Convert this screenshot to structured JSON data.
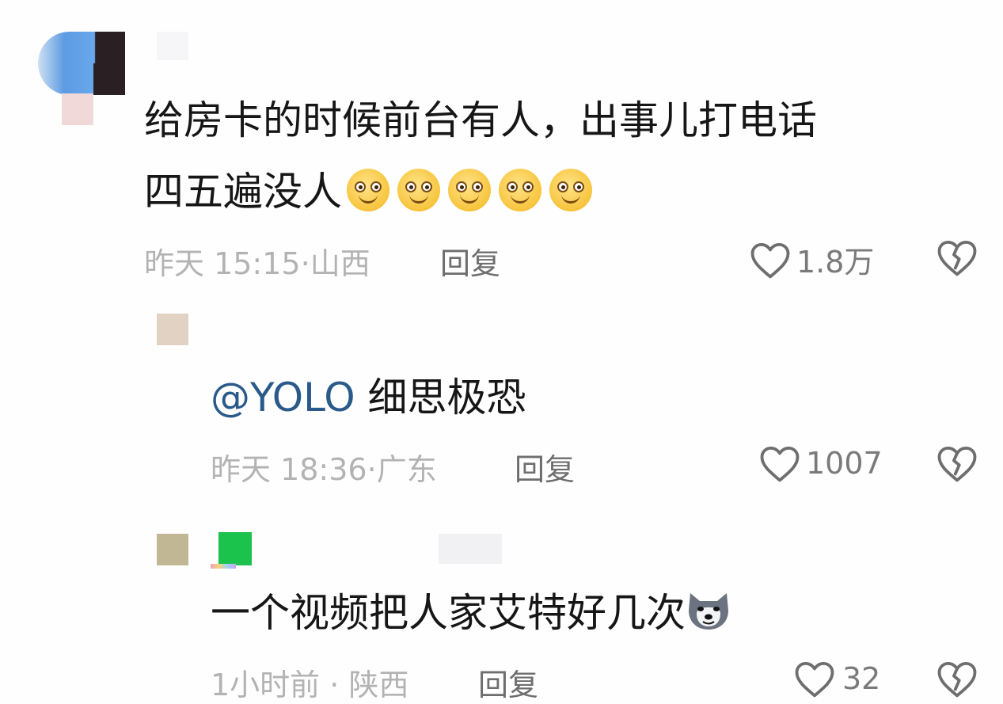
{
  "comments": [
    {
      "body": "给房卡的时候前台有人，出事儿打电话",
      "body_line2": "四五遍没人",
      "emoji_name": "wow-face-icon",
      "emoji_count": 5,
      "time": "昨天 15:15",
      "location": "山西",
      "reply_label": "回复",
      "likes": "1.8万"
    },
    {
      "mention": "@YOLO",
      "body": "细思极恐",
      "time": "昨天 18:36",
      "location": "广东",
      "reply_label": "回复",
      "likes": "1007"
    },
    {
      "body": "一个视频把人家艾特好几次",
      "emoji_name": "husky-dog-icon",
      "time": "1小时前",
      "location": "陕西",
      "reply_label": "回复",
      "likes": "32"
    }
  ],
  "separator": "·",
  "colors": {
    "text": "#161616",
    "meta": "#b3b3b3",
    "reply": "#6e6e6e",
    "mention": "#2a5a8a"
  }
}
